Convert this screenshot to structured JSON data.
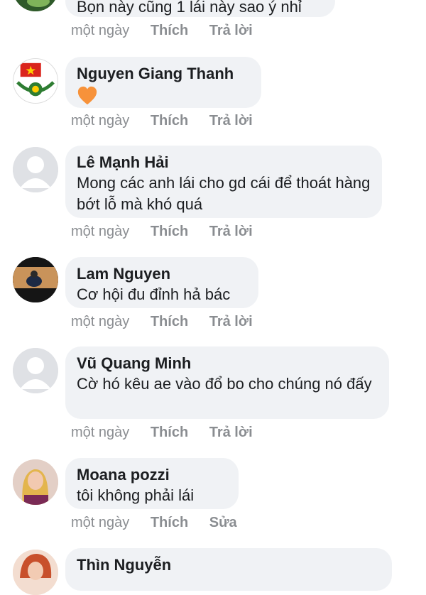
{
  "comments": [
    {
      "author": "",
      "text": "Bọn này cũng 1 lái này sao ý nhỉ",
      "time": "một ngày",
      "like": "Thích",
      "action": "Trả lời"
    },
    {
      "author": "Nguyen Giang Thanh",
      "text": "",
      "emoji": "orange-heart",
      "time": "một ngày",
      "like": "Thích",
      "action": "Trả lời"
    },
    {
      "author": "Lê Mạnh Hải",
      "text": "Mong các anh lái cho gd cái để thoát hàng bớt lỗ mà khó quá",
      "time": "một ngày",
      "like": "Thích",
      "action": "Trả lời"
    },
    {
      "author": "Lam Nguyen",
      "text": "Cơ hội đu đỉnh hả bác",
      "time": "một ngày",
      "like": "Thích",
      "action": "Trả lời"
    },
    {
      "author": "Vũ Quang Minh",
      "text": "Cờ hó kêu ae vào đổ bo cho chúng nó đấy",
      "time": "một ngày",
      "like": "Thích",
      "action": "Trả lời"
    },
    {
      "author": "Moana pozzi",
      "text": "tôi không phải lái",
      "time": "một ngày",
      "like": "Thích",
      "action": "Sửa"
    },
    {
      "author": "Thìn Nguyễn",
      "text": "",
      "time": "",
      "like": "",
      "action": ""
    }
  ],
  "colors": {
    "bubble": "#f0f2f5",
    "meta": "#8a8d91",
    "heart": "#f7923a"
  }
}
